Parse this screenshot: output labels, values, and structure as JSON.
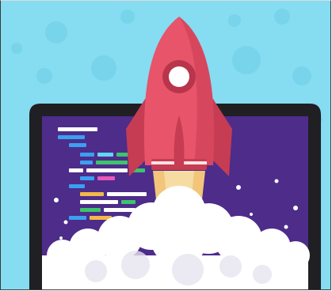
{
  "illustration": {
    "subject": "rocket-launching-from-laptop-screen",
    "colors": {
      "sky": "#86dcf0",
      "sky_dots": "#6ecde6",
      "bezel": "#1f1f24",
      "screen": "#4d2c8a",
      "rocket_body": "#e8546a",
      "rocket_shadow": "#c63c53",
      "window_ring": "#b8354c",
      "window": "#ffffff",
      "flame_outer": "#f2c57a",
      "flame_inner": "#f7dca2",
      "smoke": "#ffffff",
      "smoke_shade": "#e6e4ee",
      "code_white": "#ffffff",
      "code_blue": "#3aa0f0",
      "code_green": "#3ec46d",
      "code_yellow": "#f2b84b",
      "code_magenta": "#e858b8",
      "code_cyan": "#61d6f2"
    },
    "icons": [
      "rocket-icon",
      "laptop-icon",
      "code-lines",
      "smoke-cloud"
    ]
  }
}
